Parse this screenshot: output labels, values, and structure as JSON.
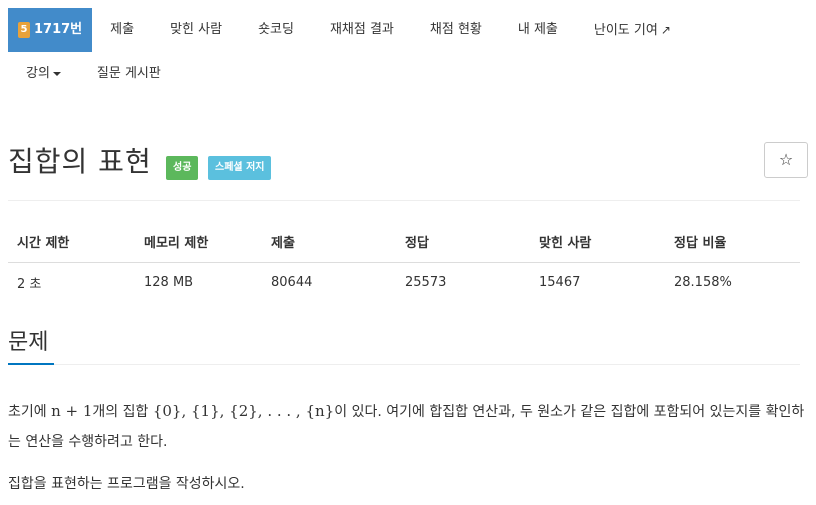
{
  "nav": {
    "problem_number_badge": "5",
    "problem_number": "1717번",
    "items": [
      "제출",
      "맞힌 사람",
      "숏코딩",
      "재채점 결과",
      "채점 현황",
      "내 제출",
      "난이도 기여"
    ],
    "row2": [
      "강의",
      "질문 게시판"
    ]
  },
  "problem": {
    "title": "집합의 표현",
    "labels": [
      "성공",
      "스페셜 저지"
    ],
    "star": "☆",
    "stats": {
      "headers": [
        "시간 제한",
        "메모리 제한",
        "제출",
        "정답",
        "맞힌 사람",
        "정답 비율"
      ],
      "values": [
        "2 초",
        "128 MB",
        "80644",
        "25573",
        "15467",
        "28.158%"
      ]
    },
    "section_title": "문제",
    "text": {
      "p1_a": "초기에 ",
      "p1_math1": "n + 1",
      "p1_b": "개의 집합 ",
      "p1_math2": "{0}, {1}, {2}, . . . , {n}",
      "p1_c": "이 있다. 여기에 합집합 연산과, 두 원소가 같은 집합에 포함되어 있는지를 확인하는 연산을 수행하려고 한다.",
      "p2": "집합을 표현하는 프로그램을 작성하시오."
    }
  },
  "colors": {
    "active_nav": "#428bca",
    "badge5": "#e8a23b",
    "success": "#5cb85c",
    "special": "#5bc0de",
    "section_accent": "#0076c0"
  }
}
